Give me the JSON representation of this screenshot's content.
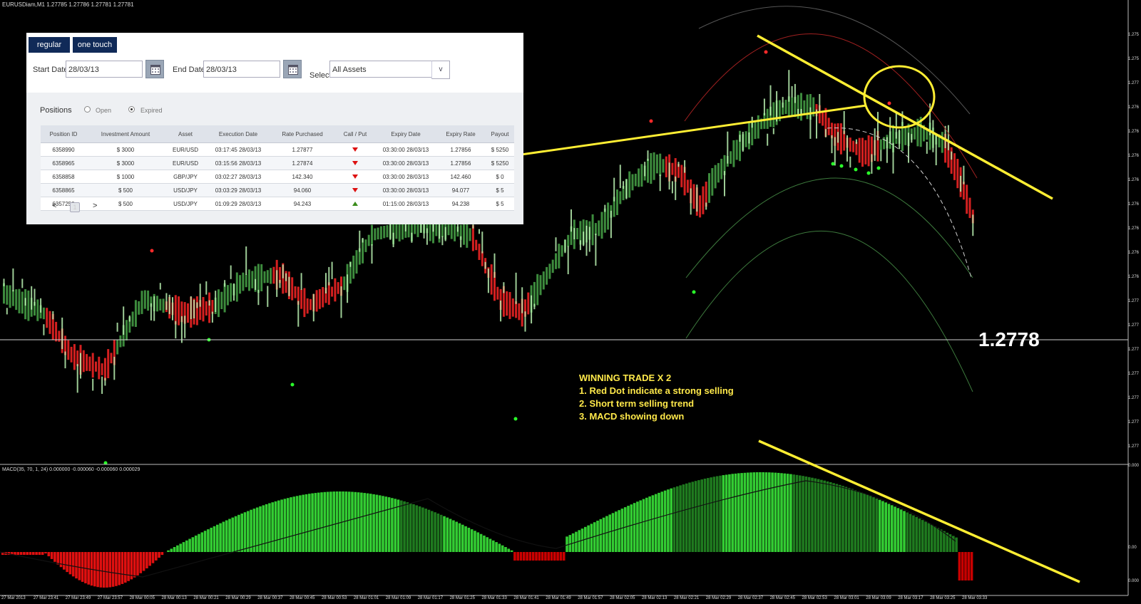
{
  "chart": {
    "symbol_header": "EURUSDiam,M1 1.27785 1.27786 1.27781 1.27781",
    "macd_header": "MACD(35, 70, 1, 24) 0.000000 -0.000060 -0.000060 0.000029",
    "current_price_label": "1.2778",
    "y_axis_labels": [
      "1.275",
      "1.275",
      "1.277",
      "1.276",
      "1.276",
      "1.276",
      "1.276",
      "1.276",
      "1.276",
      "1.276",
      "1.276",
      "1.277",
      "1.277",
      "1.277",
      "1.277",
      "1.277",
      "1.277",
      "1.277",
      "1.277"
    ],
    "macd_axis_labels": [
      "0.000",
      "0.00",
      "0.000"
    ],
    "x_axis_labels": [
      "27 Mar 2013",
      "27 Mar 23:41",
      "27 Mar 23:49",
      "27 Mar 23:57",
      "28 Mar 00:05",
      "28 Mar 00:13",
      "28 Mar 00:21",
      "28 Mar 00:29",
      "28 Mar 00:37",
      "28 Mar 00:45",
      "28 Mar 00:53",
      "28 Mar 01:01",
      "28 Mar 01:09",
      "28 Mar 01:17",
      "28 Mar 01:25",
      "28 Mar 01:33",
      "28 Mar 01:41",
      "28 Mar 01:49",
      "28 Mar 01:57",
      "28 Mar 02:05",
      "28 Mar 02:13",
      "28 Mar 02:21",
      "28 Mar 02:29",
      "28 Mar 02:37",
      "28 Mar 02:45",
      "28 Mar 02:53",
      "28 Mar 03:01",
      "28 Mar 03:09",
      "28 Mar 03:17",
      "28 Mar 03:25",
      "28 Mar 03:33"
    ],
    "colors": {
      "bull_bar": "#3d8b3d",
      "bear_bar": "#d42020",
      "candle": "#b8f0b0",
      "annotation": "#ffee33",
      "macd_up": "#33cc33",
      "macd_down": "#e01010"
    }
  },
  "annotation": {
    "title": "WINNING TRADE X 2",
    "points": [
      "1. Red Dot indicate a strong selling",
      "2. Short term selling trend",
      "3. MACD showing down"
    ]
  },
  "panel": {
    "tabs": [
      "regular",
      "one touch"
    ],
    "start_date_label": "Start Date",
    "start_date_value": "28/03/13",
    "end_date_label": "End Date",
    "end_date_value": "28/03/13",
    "select_label": "Select",
    "select_value": "All Assets",
    "select_arrow": "v",
    "positions_label": "Positions",
    "radio_open": "Open",
    "radio_expired": "Expired",
    "columns": [
      "Position ID",
      "Investment Amount",
      "Asset",
      "Execution Date",
      "Rate Purchased",
      "Call / Put",
      "Expiry Date",
      "Expiry Rate",
      "Payout"
    ],
    "rows": [
      {
        "id": "6358990",
        "amount": "$ 3000",
        "asset": "EUR/USD",
        "exec": "03:17:45 28/03/13",
        "rate": "1.27877",
        "dir": "put",
        "expiry": "03:30:00 28/03/13",
        "exp_rate": "1.27856",
        "payout": "$ 5250"
      },
      {
        "id": "6358965",
        "amount": "$ 3000",
        "asset": "EUR/USD",
        "exec": "03:15:56 28/03/13",
        "rate": "1.27874",
        "dir": "put",
        "expiry": "03:30:00 28/03/13",
        "exp_rate": "1.27856",
        "payout": "$ 5250"
      },
      {
        "id": "6358858",
        "amount": "$ 1000",
        "asset": "GBP/JPY",
        "exec": "03:02:27 28/03/13",
        "rate": "142.340",
        "dir": "put",
        "expiry": "03:30:00 28/03/13",
        "exp_rate": "142.460",
        "payout": "$ 0"
      },
      {
        "id": "6358865",
        "amount": "$ 500",
        "asset": "USD/JPY",
        "exec": "03:03:29 28/03/13",
        "rate": "94.060",
        "dir": "put",
        "expiry": "03:30:00 28/03/13",
        "exp_rate": "94.077",
        "payout": "$ 5"
      },
      {
        "id": "6357250",
        "amount": "$ 500",
        "asset": "USD/JPY",
        "exec": "01:09:29 28/03/13",
        "rate": "94.243",
        "dir": "call",
        "expiry": "01:15:00 28/03/13",
        "exp_rate": "94.238",
        "payout": "$ 5"
      }
    ],
    "pager_prev": "<",
    "pager_page": "1",
    "pager_next": ">"
  }
}
